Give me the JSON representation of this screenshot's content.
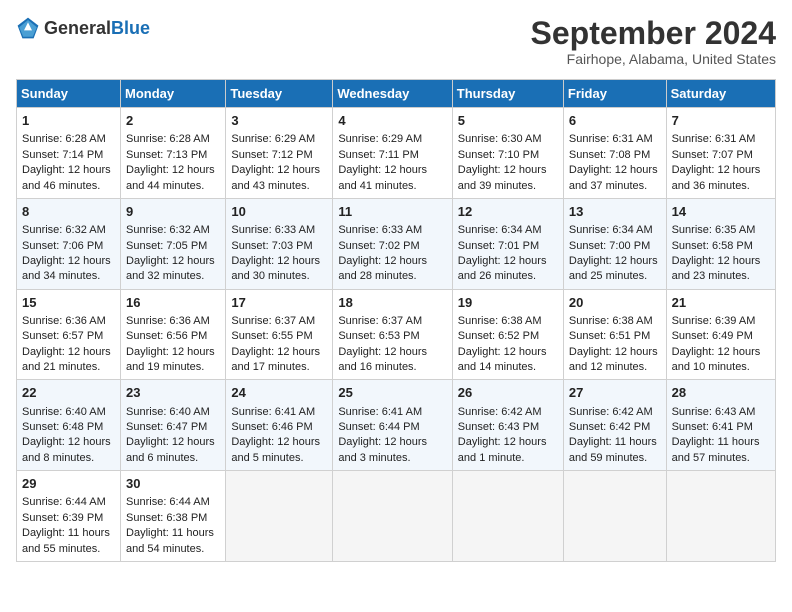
{
  "header": {
    "logo_general": "General",
    "logo_blue": "Blue",
    "title": "September 2024",
    "subtitle": "Fairhope, Alabama, United States"
  },
  "columns": [
    "Sunday",
    "Monday",
    "Tuesday",
    "Wednesday",
    "Thursday",
    "Friday",
    "Saturday"
  ],
  "weeks": [
    [
      {
        "day": "1",
        "rise": "6:28 AM",
        "set": "7:14 PM",
        "daylight": "12 hours and 46 minutes."
      },
      {
        "day": "2",
        "rise": "6:28 AM",
        "set": "7:13 PM",
        "daylight": "12 hours and 44 minutes."
      },
      {
        "day": "3",
        "rise": "6:29 AM",
        "set": "7:12 PM",
        "daylight": "12 hours and 43 minutes."
      },
      {
        "day": "4",
        "rise": "6:29 AM",
        "set": "7:11 PM",
        "daylight": "12 hours and 41 minutes."
      },
      {
        "day": "5",
        "rise": "6:30 AM",
        "set": "7:10 PM",
        "daylight": "12 hours and 39 minutes."
      },
      {
        "day": "6",
        "rise": "6:31 AM",
        "set": "7:08 PM",
        "daylight": "12 hours and 37 minutes."
      },
      {
        "day": "7",
        "rise": "6:31 AM",
        "set": "7:07 PM",
        "daylight": "12 hours and 36 minutes."
      }
    ],
    [
      {
        "day": "8",
        "rise": "6:32 AM",
        "set": "7:06 PM",
        "daylight": "12 hours and 34 minutes."
      },
      {
        "day": "9",
        "rise": "6:32 AM",
        "set": "7:05 PM",
        "daylight": "12 hours and 32 minutes."
      },
      {
        "day": "10",
        "rise": "6:33 AM",
        "set": "7:03 PM",
        "daylight": "12 hours and 30 minutes."
      },
      {
        "day": "11",
        "rise": "6:33 AM",
        "set": "7:02 PM",
        "daylight": "12 hours and 28 minutes."
      },
      {
        "day": "12",
        "rise": "6:34 AM",
        "set": "7:01 PM",
        "daylight": "12 hours and 26 minutes."
      },
      {
        "day": "13",
        "rise": "6:34 AM",
        "set": "7:00 PM",
        "daylight": "12 hours and 25 minutes."
      },
      {
        "day": "14",
        "rise": "6:35 AM",
        "set": "6:58 PM",
        "daylight": "12 hours and 23 minutes."
      }
    ],
    [
      {
        "day": "15",
        "rise": "6:36 AM",
        "set": "6:57 PM",
        "daylight": "12 hours and 21 minutes."
      },
      {
        "day": "16",
        "rise": "6:36 AM",
        "set": "6:56 PM",
        "daylight": "12 hours and 19 minutes."
      },
      {
        "day": "17",
        "rise": "6:37 AM",
        "set": "6:55 PM",
        "daylight": "12 hours and 17 minutes."
      },
      {
        "day": "18",
        "rise": "6:37 AM",
        "set": "6:53 PM",
        "daylight": "12 hours and 16 minutes."
      },
      {
        "day": "19",
        "rise": "6:38 AM",
        "set": "6:52 PM",
        "daylight": "12 hours and 14 minutes."
      },
      {
        "day": "20",
        "rise": "6:38 AM",
        "set": "6:51 PM",
        "daylight": "12 hours and 12 minutes."
      },
      {
        "day": "21",
        "rise": "6:39 AM",
        "set": "6:49 PM",
        "daylight": "12 hours and 10 minutes."
      }
    ],
    [
      {
        "day": "22",
        "rise": "6:40 AM",
        "set": "6:48 PM",
        "daylight": "12 hours and 8 minutes."
      },
      {
        "day": "23",
        "rise": "6:40 AM",
        "set": "6:47 PM",
        "daylight": "12 hours and 6 minutes."
      },
      {
        "day": "24",
        "rise": "6:41 AM",
        "set": "6:46 PM",
        "daylight": "12 hours and 5 minutes."
      },
      {
        "day": "25",
        "rise": "6:41 AM",
        "set": "6:44 PM",
        "daylight": "12 hours and 3 minutes."
      },
      {
        "day": "26",
        "rise": "6:42 AM",
        "set": "6:43 PM",
        "daylight": "12 hours and 1 minute."
      },
      {
        "day": "27",
        "rise": "6:42 AM",
        "set": "6:42 PM",
        "daylight": "11 hours and 59 minutes."
      },
      {
        "day": "28",
        "rise": "6:43 AM",
        "set": "6:41 PM",
        "daylight": "11 hours and 57 minutes."
      }
    ],
    [
      {
        "day": "29",
        "rise": "6:44 AM",
        "set": "6:39 PM",
        "daylight": "11 hours and 55 minutes."
      },
      {
        "day": "30",
        "rise": "6:44 AM",
        "set": "6:38 PM",
        "daylight": "11 hours and 54 minutes."
      },
      null,
      null,
      null,
      null,
      null
    ]
  ]
}
